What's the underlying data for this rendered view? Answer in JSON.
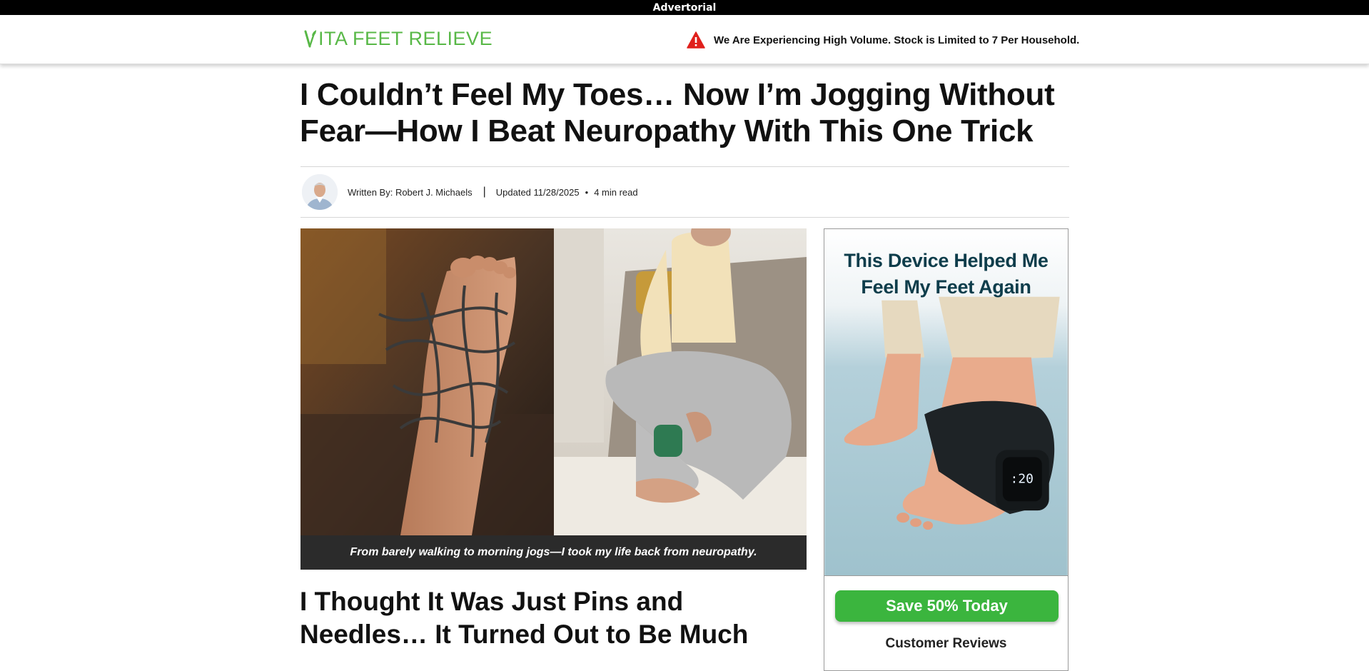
{
  "ad_banner": {
    "label": "Advertorial"
  },
  "header": {
    "logo_text": "ITA FEET RELIEVE",
    "notice": "We Are Experiencing High Volume. Stock is Limited to 7 Per Household."
  },
  "article": {
    "headline": "I Couldn’t Feel My Toes… Now I’m Jogging Without Fear—How I Beat Neuropathy With This One Trick",
    "byline": {
      "author": "Written By: Robert J. Michaels",
      "separator": "|",
      "updated": "Updated 11/28/2025",
      "dot": "•",
      "read_time": "4 min read"
    },
    "hero_caption": "From barely walking to morning jogs—I took my life back from neuropathy.",
    "subheading": "I Thought It Was Just Pins and Needles… It Turned Out to Be Much"
  },
  "sidebar": {
    "ad_title": "This Device Helped Me Feel My Feet Again",
    "cta_label": "Save 50% Today",
    "reviews_title": "Customer Reviews"
  },
  "colors": {
    "brand_green": "#58b847",
    "cta_green": "#3bb53e",
    "ad_title": "#0e3d4b",
    "warning_red": "#e0201c"
  }
}
